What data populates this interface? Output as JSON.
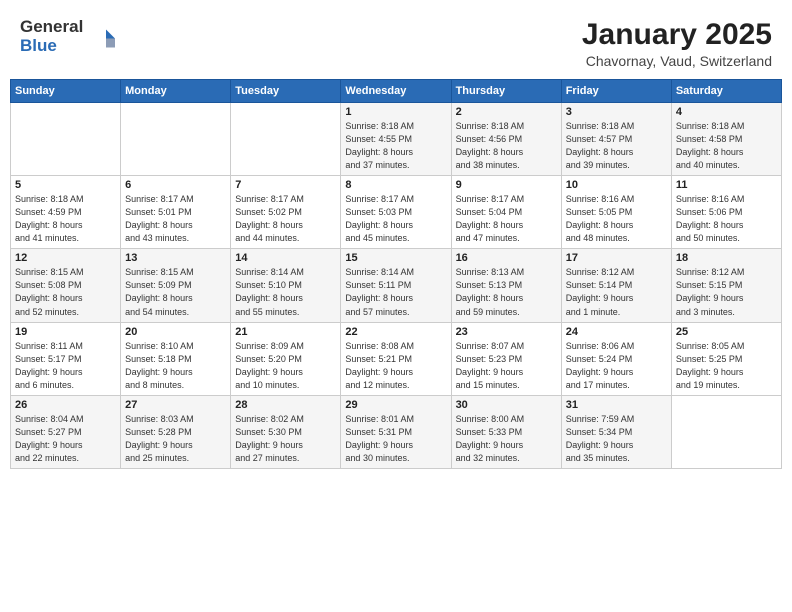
{
  "logo": {
    "general": "General",
    "blue": "Blue"
  },
  "title": {
    "month": "January 2025",
    "location": "Chavornay, Vaud, Switzerland"
  },
  "weekdays": [
    "Sunday",
    "Monday",
    "Tuesday",
    "Wednesday",
    "Thursday",
    "Friday",
    "Saturday"
  ],
  "weeks": [
    [
      {
        "day": "",
        "info": ""
      },
      {
        "day": "",
        "info": ""
      },
      {
        "day": "",
        "info": ""
      },
      {
        "day": "1",
        "info": "Sunrise: 8:18 AM\nSunset: 4:55 PM\nDaylight: 8 hours\nand 37 minutes."
      },
      {
        "day": "2",
        "info": "Sunrise: 8:18 AM\nSunset: 4:56 PM\nDaylight: 8 hours\nand 38 minutes."
      },
      {
        "day": "3",
        "info": "Sunrise: 8:18 AM\nSunset: 4:57 PM\nDaylight: 8 hours\nand 39 minutes."
      },
      {
        "day": "4",
        "info": "Sunrise: 8:18 AM\nSunset: 4:58 PM\nDaylight: 8 hours\nand 40 minutes."
      }
    ],
    [
      {
        "day": "5",
        "info": "Sunrise: 8:18 AM\nSunset: 4:59 PM\nDaylight: 8 hours\nand 41 minutes."
      },
      {
        "day": "6",
        "info": "Sunrise: 8:17 AM\nSunset: 5:01 PM\nDaylight: 8 hours\nand 43 minutes."
      },
      {
        "day": "7",
        "info": "Sunrise: 8:17 AM\nSunset: 5:02 PM\nDaylight: 8 hours\nand 44 minutes."
      },
      {
        "day": "8",
        "info": "Sunrise: 8:17 AM\nSunset: 5:03 PM\nDaylight: 8 hours\nand 45 minutes."
      },
      {
        "day": "9",
        "info": "Sunrise: 8:17 AM\nSunset: 5:04 PM\nDaylight: 8 hours\nand 47 minutes."
      },
      {
        "day": "10",
        "info": "Sunrise: 8:16 AM\nSunset: 5:05 PM\nDaylight: 8 hours\nand 48 minutes."
      },
      {
        "day": "11",
        "info": "Sunrise: 8:16 AM\nSunset: 5:06 PM\nDaylight: 8 hours\nand 50 minutes."
      }
    ],
    [
      {
        "day": "12",
        "info": "Sunrise: 8:15 AM\nSunset: 5:08 PM\nDaylight: 8 hours\nand 52 minutes."
      },
      {
        "day": "13",
        "info": "Sunrise: 8:15 AM\nSunset: 5:09 PM\nDaylight: 8 hours\nand 54 minutes."
      },
      {
        "day": "14",
        "info": "Sunrise: 8:14 AM\nSunset: 5:10 PM\nDaylight: 8 hours\nand 55 minutes."
      },
      {
        "day": "15",
        "info": "Sunrise: 8:14 AM\nSunset: 5:11 PM\nDaylight: 8 hours\nand 57 minutes."
      },
      {
        "day": "16",
        "info": "Sunrise: 8:13 AM\nSunset: 5:13 PM\nDaylight: 8 hours\nand 59 minutes."
      },
      {
        "day": "17",
        "info": "Sunrise: 8:12 AM\nSunset: 5:14 PM\nDaylight: 9 hours\nand 1 minute."
      },
      {
        "day": "18",
        "info": "Sunrise: 8:12 AM\nSunset: 5:15 PM\nDaylight: 9 hours\nand 3 minutes."
      }
    ],
    [
      {
        "day": "19",
        "info": "Sunrise: 8:11 AM\nSunset: 5:17 PM\nDaylight: 9 hours\nand 6 minutes."
      },
      {
        "day": "20",
        "info": "Sunrise: 8:10 AM\nSunset: 5:18 PM\nDaylight: 9 hours\nand 8 minutes."
      },
      {
        "day": "21",
        "info": "Sunrise: 8:09 AM\nSunset: 5:20 PM\nDaylight: 9 hours\nand 10 minutes."
      },
      {
        "day": "22",
        "info": "Sunrise: 8:08 AM\nSunset: 5:21 PM\nDaylight: 9 hours\nand 12 minutes."
      },
      {
        "day": "23",
        "info": "Sunrise: 8:07 AM\nSunset: 5:23 PM\nDaylight: 9 hours\nand 15 minutes."
      },
      {
        "day": "24",
        "info": "Sunrise: 8:06 AM\nSunset: 5:24 PM\nDaylight: 9 hours\nand 17 minutes."
      },
      {
        "day": "25",
        "info": "Sunrise: 8:05 AM\nSunset: 5:25 PM\nDaylight: 9 hours\nand 19 minutes."
      }
    ],
    [
      {
        "day": "26",
        "info": "Sunrise: 8:04 AM\nSunset: 5:27 PM\nDaylight: 9 hours\nand 22 minutes."
      },
      {
        "day": "27",
        "info": "Sunrise: 8:03 AM\nSunset: 5:28 PM\nDaylight: 9 hours\nand 25 minutes."
      },
      {
        "day": "28",
        "info": "Sunrise: 8:02 AM\nSunset: 5:30 PM\nDaylight: 9 hours\nand 27 minutes."
      },
      {
        "day": "29",
        "info": "Sunrise: 8:01 AM\nSunset: 5:31 PM\nDaylight: 9 hours\nand 30 minutes."
      },
      {
        "day": "30",
        "info": "Sunrise: 8:00 AM\nSunset: 5:33 PM\nDaylight: 9 hours\nand 32 minutes."
      },
      {
        "day": "31",
        "info": "Sunrise: 7:59 AM\nSunset: 5:34 PM\nDaylight: 9 hours\nand 35 minutes."
      },
      {
        "day": "",
        "info": ""
      }
    ]
  ]
}
